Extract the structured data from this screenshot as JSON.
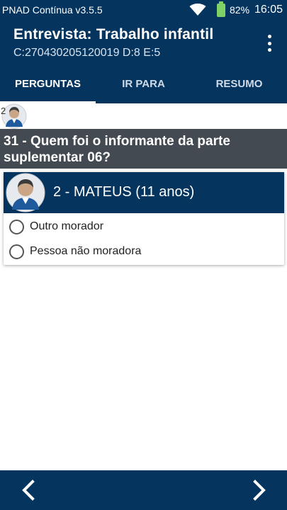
{
  "status_bar": {
    "app_name": "PNAD Contínua v3.5.5",
    "battery": "82%",
    "time": "16:05",
    "icons": [
      "wifi-icon",
      "battery-icon"
    ]
  },
  "app_bar": {
    "title": "Entrevista: Trabalho infantil",
    "subtitle": "C:270430205120019 D:8 E:5",
    "menu_icon": "more-vert-icon"
  },
  "tabs": [
    {
      "label": "PERGUNTAS",
      "active": true
    },
    {
      "label": "IR PARA",
      "active": false
    },
    {
      "label": "RESUMO",
      "active": false
    }
  ],
  "mini_row": {
    "number": "2"
  },
  "question": {
    "text": "31 - Quem foi o informante da parte suplementar 06?"
  },
  "card": {
    "person": "2 - MATEUS (11 anos)",
    "options": [
      {
        "label": "Outro morador",
        "selected": false
      },
      {
        "label": "Pessoa não moradora",
        "selected": false
      }
    ]
  },
  "bottom_nav": {
    "prev_icon": "chevron-left-icon",
    "next_icon": "chevron-right-icon"
  },
  "colors": {
    "primary": "#05355f",
    "question_bg": "#444a52",
    "battery": "#7ed167"
  }
}
